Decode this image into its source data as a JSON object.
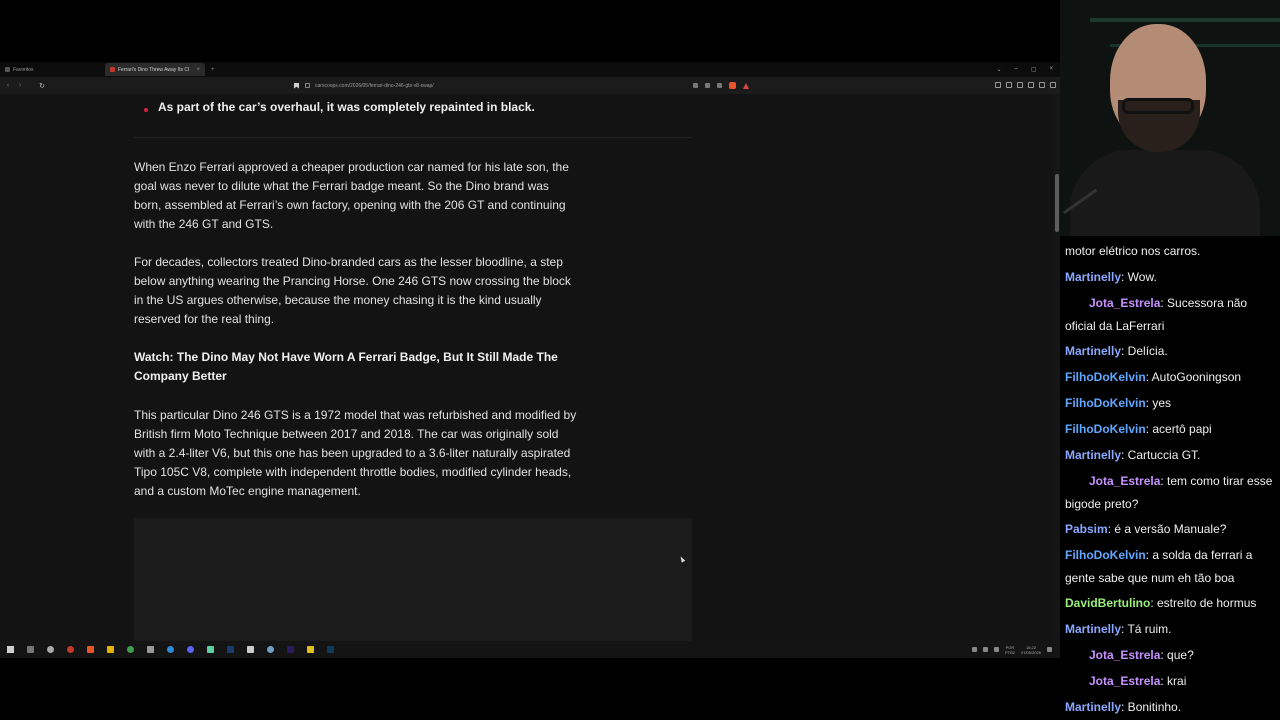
{
  "browser": {
    "tabs": [
      {
        "label": "Favoritos"
      },
      {
        "label": "Ferrari's Dino Threw Away Its Cl",
        "close": "×"
      }
    ],
    "new_tab": "+",
    "window_controls": [
      "⌄",
      "–",
      "▢",
      "×"
    ],
    "nav": {
      "back": "‹",
      "forward": "›",
      "reload": "↻"
    },
    "url": "carscoops.com/2026/05/ferrari-dino-246-gts-v8-swap/"
  },
  "article": {
    "bullet": "As part of the car’s overhaul, it was completely repainted in black.",
    "paragraphs": [
      "When Enzo Ferrari approved a cheaper production car named for his late son, the goal was never to dilute what the Ferrari badge meant. So the Dino brand was born, assembled at Ferrari’s own factory, opening with the 206 GT and continuing with the 246 GT and GTS.",
      "For decades, collectors treated Dino-branded cars as the lesser bloodline, a step below anything wearing the Prancing Horse. One 246 GTS now crossing the block in the US argues otherwise, because the money chasing it is the kind usually reserved for the real thing.",
      "This particular Dino 246 GTS is a 1972 model that was refurbished and modified by British firm Moto Technique between 2017 and 2018. The car was originally sold with a 2.4-liter V6, but this one has been upgraded to a 3.6-liter naturally aspirated Tipo 105C V8, complete with independent throttle bodies, modified cylinder heads, and a custom MoTec engine management."
    ],
    "watch_heading": "Watch: The Dino May Not Have Worn A Ferrari Badge, But It Still Made The Company Better"
  },
  "taskbar": {
    "icons": [
      "start-icon",
      "task-view-icon",
      "obs-icon",
      "brave-icon",
      "file-explorer-icon",
      "chrome-icon",
      "calculator-icon",
      "browser-icon",
      "discord-icon",
      "notepad-icon",
      "audition-icon",
      "app-icon",
      "network-icon",
      "premiere-icon",
      "app-icon-2",
      "photoshop-icon"
    ],
    "lang": [
      "POR",
      "PTB2"
    ],
    "clock": [
      "16:22",
      "07/05/2026"
    ]
  },
  "chat": {
    "messages": [
      {
        "user": "",
        "text": "motor elétrico nos carros.",
        "color": "#efefef"
      },
      {
        "user": "Martinelly",
        "text": ": Wow.",
        "color": "#8aa8ff"
      },
      {
        "user": "Jota_Estrela",
        "text": ": Sucessora não oficial da LaFerrari",
        "color": "#c792ff"
      },
      {
        "user": "Martinelly",
        "text": ": Delícia.",
        "color": "#8aa8ff"
      },
      {
        "user": "FilhoDoKelvin",
        "text": ": AutoGooningson",
        "color": "#5fa8ff"
      },
      {
        "user": "FilhoDoKelvin",
        "text": ": yes",
        "color": "#5fa8ff"
      },
      {
        "user": "FilhoDoKelvin",
        "text": ": acertô papi",
        "color": "#5fa8ff"
      },
      {
        "user": "Martinelly",
        "text": ": Cartuccia GT.",
        "color": "#8aa8ff"
      },
      {
        "user": "Jota_Estrela",
        "text": ": tem como tirar esse bigode preto?",
        "color": "#c792ff"
      },
      {
        "user": "Pabsim",
        "text": ": é a versão Manuale?",
        "color": "#8aa8ff"
      },
      {
        "user": "FilhoDoKelvin",
        "text": ": a solda da ferrari a gente sabe que num eh tão boa",
        "color": "#5fa8ff"
      },
      {
        "user": "DavidBertulino",
        "text": ": estreito de hormus",
        "color": "#9bf07a"
      },
      {
        "user": "Martinelly",
        "text": ": Tá ruim.",
        "color": "#8aa8ff"
      },
      {
        "user": "Jota_Estrela",
        "text": ": que?",
        "color": "#c792ff"
      },
      {
        "user": "Jota_Estrela",
        "text": ": krai",
        "color": "#c792ff"
      },
      {
        "user": "Martinelly",
        "text": ": Bonitinho.",
        "color": "#8aa8ff"
      }
    ]
  },
  "colors": {
    "accent": "#d2273a",
    "page_bg": "#131313",
    "text": "#e2e2e2"
  }
}
